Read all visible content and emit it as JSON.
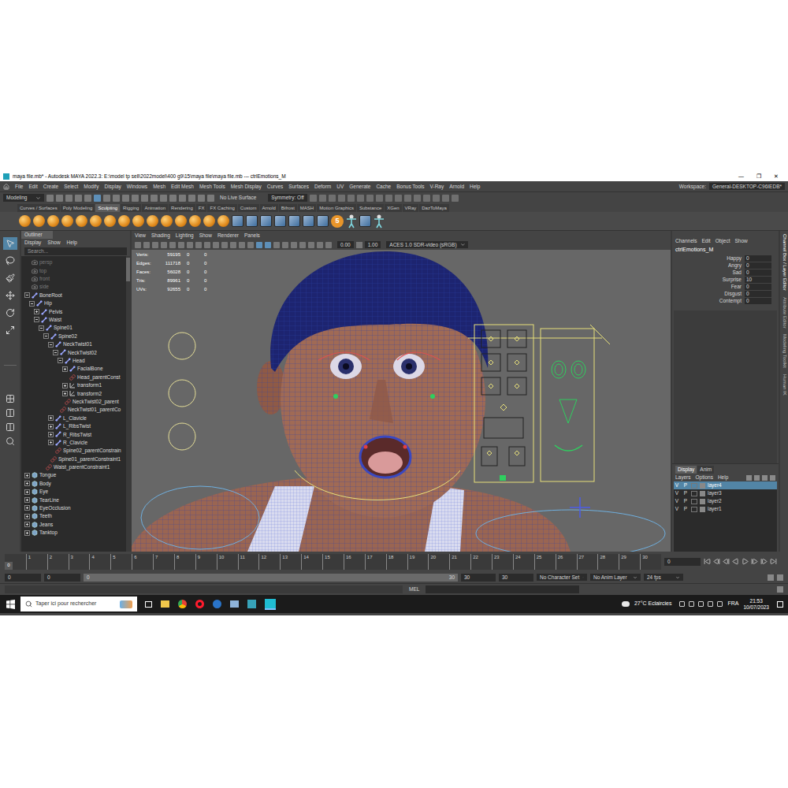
{
  "window": {
    "title": "maya file.mb* - Autodesk MAYA 2022.3: E:\\model tp sell\\2022model\\400 g9\\15\\maya file\\maya file.mb  ---  ctrlEmotions_M",
    "controls": [
      "—",
      "❐",
      "✕"
    ]
  },
  "menu": [
    "File",
    "Edit",
    "Create",
    "Select",
    "Modify",
    "Display",
    "Windows",
    "Mesh",
    "Edit Mesh",
    "Mesh Tools",
    "Mesh Display",
    "Curves",
    "Surfaces",
    "Deform",
    "UV",
    "Generate",
    "Cache",
    "Bonus Tools",
    "V-Ray",
    "Arnold",
    "Help"
  ],
  "workspace": {
    "label": "Workspace:",
    "value": "General-DESKTOP-C96IEDB*"
  },
  "status_line": {
    "mode": "Modeling",
    "live_surface": "No Live Surface",
    "symmetry": "Symmetry: Off"
  },
  "shelf": {
    "tabs": [
      {
        "label": "Curves / Surfaces",
        "selected": false
      },
      {
        "label": "Poly Modeling",
        "selected": false
      },
      {
        "label": "Sculpting",
        "selected": true
      },
      {
        "label": "Rigging",
        "selected": false
      },
      {
        "label": "Animation",
        "selected": false
      },
      {
        "label": "Rendering",
        "selected": false
      },
      {
        "label": "FX",
        "selected": false
      },
      {
        "label": "FX Caching",
        "selected": false
      },
      {
        "label": "Custom",
        "selected": false
      },
      {
        "label": "Arnold",
        "selected": false
      },
      {
        "label": "Bifrost",
        "selected": false
      },
      {
        "label": "MASH",
        "selected": false
      },
      {
        "label": "Motion Graphics",
        "selected": false
      },
      {
        "label": "Substance",
        "selected": false
      },
      {
        "label": "XGen",
        "selected": false
      },
      {
        "label": "VRay",
        "selected": false
      },
      {
        "label": "DazToMaya",
        "selected": false
      }
    ],
    "icons": [
      {
        "kind": "sphere",
        "label": ""
      },
      {
        "kind": "sphere",
        "label": ""
      },
      {
        "kind": "sphere",
        "label": ""
      },
      {
        "kind": "sphere",
        "label": ""
      },
      {
        "kind": "sphere",
        "label": ""
      },
      {
        "kind": "sphere",
        "label": ""
      },
      {
        "kind": "sphere",
        "label": ""
      },
      {
        "kind": "sphere",
        "label": ""
      },
      {
        "kind": "sphere",
        "label": ""
      },
      {
        "kind": "sphere",
        "label": ""
      },
      {
        "kind": "sphere",
        "label": ""
      },
      {
        "kind": "sphere",
        "label": ""
      },
      {
        "kind": "sphere",
        "label": ""
      },
      {
        "kind": "sphere",
        "label": ""
      },
      {
        "kind": "sphere",
        "label": ""
      },
      {
        "kind": "tool",
        "label": ""
      },
      {
        "kind": "tool",
        "label": ""
      },
      {
        "kind": "tool",
        "label": ""
      },
      {
        "kind": "tool",
        "label": ""
      },
      {
        "kind": "tool",
        "label": ""
      },
      {
        "kind": "tool",
        "label": ""
      },
      {
        "kind": "tool",
        "label": ""
      },
      {
        "kind": "badge",
        "label": "5"
      },
      {
        "kind": "figure",
        "label": ""
      },
      {
        "kind": "tool",
        "label": ""
      },
      {
        "kind": "figure",
        "label": ""
      }
    ]
  },
  "outliner": {
    "title": "Outliner",
    "menu": [
      "Display",
      "Show",
      "Help"
    ],
    "search": "Search...",
    "items": [
      {
        "name": "persp",
        "kind": "camera",
        "depth": 0,
        "expandable": false,
        "expanded": false,
        "dimmed": true
      },
      {
        "name": "top",
        "kind": "camera",
        "depth": 0,
        "expandable": false,
        "expanded": false,
        "dimmed": true
      },
      {
        "name": "front",
        "kind": "camera",
        "depth": 0,
        "expandable": false,
        "expanded": false,
        "dimmed": true
      },
      {
        "name": "side",
        "kind": "camera",
        "depth": 0,
        "expandable": false,
        "expanded": false,
        "dimmed": true
      },
      {
        "name": "BoneRoot",
        "kind": "joint",
        "depth": 0,
        "expandable": true,
        "expanded": true,
        "dimmed": false
      },
      {
        "name": "Hip",
        "kind": "joint",
        "depth": 1,
        "expandable": true,
        "expanded": true,
        "dimmed": false
      },
      {
        "name": "Pelvis",
        "kind": "joint",
        "depth": 2,
        "expandable": true,
        "expanded": false,
        "dimmed": false
      },
      {
        "name": "Waist",
        "kind": "joint",
        "depth": 2,
        "expandable": true,
        "expanded": true,
        "dimmed": false
      },
      {
        "name": "Spine01",
        "kind": "joint",
        "depth": 3,
        "expandable": true,
        "expanded": true,
        "dimmed": false
      },
      {
        "name": "Spine02",
        "kind": "joint",
        "depth": 4,
        "expandable": true,
        "expanded": true,
        "dimmed": false
      },
      {
        "name": "NeckTwist01",
        "kind": "joint",
        "depth": 5,
        "expandable": true,
        "expanded": true,
        "dimmed": false
      },
      {
        "name": "NeckTwist02",
        "kind": "joint",
        "depth": 6,
        "expandable": true,
        "expanded": true,
        "dimmed": false
      },
      {
        "name": "Head",
        "kind": "joint",
        "depth": 7,
        "expandable": true,
        "expanded": true,
        "dimmed": false
      },
      {
        "name": "FacialBone",
        "kind": "joint",
        "depth": 8,
        "expandable": true,
        "expanded": false,
        "dimmed": false
      },
      {
        "name": "Head_parentConst",
        "kind": "constraint",
        "depth": 8,
        "expandable": false,
        "expanded": false,
        "dimmed": false
      },
      {
        "name": "transform1",
        "kind": "transform",
        "depth": 8,
        "expandable": true,
        "expanded": false,
        "dimmed": false
      },
      {
        "name": "transform2",
        "kind": "transform",
        "depth": 8,
        "expandable": true,
        "expanded": false,
        "dimmed": false
      },
      {
        "name": "NeckTwist02_parent",
        "kind": "constraint",
        "depth": 7,
        "expandable": false,
        "expanded": false,
        "dimmed": false
      },
      {
        "name": "NeckTwist01_parentCo",
        "kind": "constraint",
        "depth": 6,
        "expandable": false,
        "expanded": false,
        "dimmed": false
      },
      {
        "name": "L_Clavicle",
        "kind": "joint",
        "depth": 5,
        "expandable": true,
        "expanded": false,
        "dimmed": false
      },
      {
        "name": "L_RibsTwist",
        "kind": "joint",
        "depth": 5,
        "expandable": true,
        "expanded": false,
        "dimmed": false
      },
      {
        "name": "R_RibsTwist",
        "kind": "joint",
        "depth": 5,
        "expandable": true,
        "expanded": false,
        "dimmed": false
      },
      {
        "name": "R_Clavicle",
        "kind": "joint",
        "depth": 5,
        "expandable": true,
        "expanded": false,
        "dimmed": false
      },
      {
        "name": "Spine02_parentConstrain",
        "kind": "constraint",
        "depth": 5,
        "expandable": false,
        "expanded": false,
        "dimmed": false
      },
      {
        "name": "Spine01_parentConstraint1",
        "kind": "constraint",
        "depth": 4,
        "expandable": false,
        "expanded": false,
        "dimmed": false
      },
      {
        "name": "Waist_parentConstraint1",
        "kind": "constraint",
        "depth": 3,
        "expandable": false,
        "expanded": false,
        "dimmed": false
      },
      {
        "name": "Tongue",
        "kind": "mesh",
        "depth": 0,
        "expandable": true,
        "expanded": false,
        "dimmed": false
      },
      {
        "name": "Body",
        "kind": "mesh",
        "depth": 0,
        "expandable": true,
        "expanded": false,
        "dimmed": false
      },
      {
        "name": "Eye",
        "kind": "mesh",
        "depth": 0,
        "expandable": true,
        "expanded": false,
        "dimmed": false
      },
      {
        "name": "TearLine",
        "kind": "mesh",
        "depth": 0,
        "expandable": true,
        "expanded": false,
        "dimmed": false
      },
      {
        "name": "EyeOcclusion",
        "kind": "mesh",
        "depth": 0,
        "expandable": true,
        "expanded": false,
        "dimmed": false
      },
      {
        "name": "Teeth",
        "kind": "mesh",
        "depth": 0,
        "expandable": true,
        "expanded": false,
        "dimmed": false
      },
      {
        "name": "Jeans",
        "kind": "mesh",
        "depth": 0,
        "expandable": true,
        "expanded": false,
        "dimmed": false
      },
      {
        "name": "Tanktop",
        "kind": "mesh",
        "depth": 0,
        "expandable": true,
        "expanded": false,
        "dimmed": false
      }
    ]
  },
  "viewport": {
    "menu": [
      "View",
      "Shading",
      "Lighting",
      "Show",
      "Renderer",
      "Panels"
    ],
    "exposure": "0.00",
    "gamma": "1.00",
    "color_space": "ACES 1.0 SDR-video (sRGB)",
    "stats": [
      {
        "label": "Verts:",
        "values": [
          "59195",
          "0",
          "0"
        ]
      },
      {
        "label": "Edges:",
        "values": [
          "111718",
          "0",
          "0"
        ]
      },
      {
        "label": "Faces:",
        "values": [
          "56028",
          "0",
          "0"
        ]
      },
      {
        "label": "Tris:",
        "values": [
          "89961",
          "0",
          "0"
        ]
      },
      {
        "label": "UVs:",
        "values": [
          "92655",
          "0",
          "0"
        ]
      }
    ]
  },
  "channel_box": {
    "menu": [
      "Channels",
      "Edit",
      "Object",
      "Show"
    ],
    "node": "ctrlEmotions_M",
    "attributes": [
      {
        "name": "Happy",
        "value": "0"
      },
      {
        "name": "Angry",
        "value": "0"
      },
      {
        "name": "Sad",
        "value": "0"
      },
      {
        "name": "Surprise",
        "value": "10"
      },
      {
        "name": "Fear",
        "value": "0"
      },
      {
        "name": "Disgust",
        "value": "0"
      },
      {
        "name": "Contempt",
        "value": "0"
      }
    ]
  },
  "layer_editor": {
    "tabs": [
      {
        "label": "Display",
        "selected": true
      },
      {
        "label": "Anim",
        "selected": false
      }
    ],
    "menu": [
      "Layers",
      "Options",
      "Help"
    ],
    "layers": [
      {
        "name": "layer4",
        "v": "V",
        "p": "P",
        "selected": true
      },
      {
        "name": "layer3",
        "v": "V",
        "p": "P",
        "selected": false
      },
      {
        "name": "layer2",
        "v": "V",
        "p": "P",
        "selected": false
      },
      {
        "name": "layer1",
        "v": "V",
        "p": "P",
        "selected": false
      }
    ]
  },
  "side_tabs": [
    "Channel Box / Layer Editor",
    "Attribute Editor",
    "Modeling Toolkit",
    "Human IK"
  ],
  "timeline": {
    "current": "0",
    "ticks": [
      "1",
      "2",
      "3",
      "4",
      "5",
      "6",
      "7",
      "8",
      "9",
      "10",
      "11",
      "12",
      "13",
      "14",
      "15",
      "16",
      "17",
      "18",
      "19",
      "20",
      "21",
      "22",
      "23",
      "24",
      "25",
      "26",
      "27",
      "28",
      "29",
      "30"
    ],
    "frame_field": "0"
  },
  "range": {
    "fields_left": [
      "0",
      "0"
    ],
    "slider_start": "0",
    "slider_end": "30",
    "fields_right": [
      "30",
      "30"
    ],
    "character_set": "No Character Set",
    "anim_layer": "No Anim Layer",
    "fps": "24 fps"
  },
  "command_line": {
    "language": "MEL"
  },
  "taskbar": {
    "search": "Taper ici pour rechercher",
    "weather": "27°C  Eclaircies",
    "lang": "FRA",
    "time": "21:53",
    "date": "10/07/2023"
  }
}
